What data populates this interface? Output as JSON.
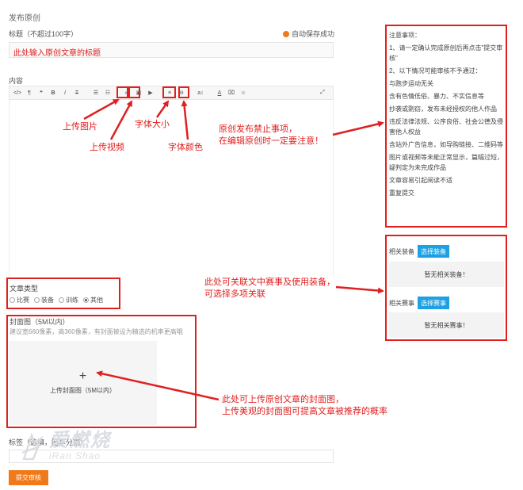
{
  "page": {
    "title": "发布原创"
  },
  "title_field": {
    "label": "标题（不超过100字）",
    "value": "此处输入原创文章的标题"
  },
  "autosave": {
    "text": "自动保存成功",
    "color": "#f07a1b"
  },
  "content": {
    "label": "内容"
  },
  "toolbar": {
    "icons": [
      "code-icon",
      "paragraph-icon",
      "quote-icon",
      "bold-icon",
      "italic-icon",
      "strikethrough-icon",
      "unordered-list-icon",
      "ordered-list-icon",
      "link-icon",
      "image-icon",
      "video-icon",
      "align-icon",
      "hr-icon",
      "font-size-icon",
      "font-color-icon",
      "clear-format-icon",
      "emoji-icon",
      "expand-icon"
    ],
    "glyphs": {
      "code": "</>",
      "paragraph": "¶",
      "quote": "❝",
      "bold": "B",
      "italic": "I",
      "strike": "T",
      "ul": "☰",
      "ol": "☷",
      "link": "∞",
      "image": "▣",
      "video": "▶",
      "align": "≡",
      "hr": "⊖",
      "fontsize": "a↕",
      "fontcolor": "A",
      "clear": "⌧",
      "emoji": "☺",
      "expand": "⤢"
    }
  },
  "annotations": {
    "upload_image": "上传图片",
    "upload_video": "上传视频",
    "font_size": "字体大小",
    "font_color": "字体颜色",
    "notice_warning_1": "原创发布禁止事项，",
    "notice_warning_2": "在编辑原创时一定要注意！",
    "relation_1": "此处可关联文中赛事及使用装备，",
    "relation_2": "可选择多项关联",
    "cover_1": "此处可上传原创文章的封面图，",
    "cover_2": "上传美观的封面图可提高文章被推荐的概率"
  },
  "article_type": {
    "label": "文章类型",
    "options": [
      {
        "label": "比赛",
        "selected": false
      },
      {
        "label": "装备",
        "selected": false
      },
      {
        "label": "训练",
        "selected": false
      },
      {
        "label": "其他",
        "selected": true
      }
    ]
  },
  "cover": {
    "label": "封面图（5M以内）",
    "hint": "建议宽660像素，高360像素，有封面被设为精选的机率更高哦",
    "plus": "+",
    "upload_text": "上传封面图（5M以内）"
  },
  "tags": {
    "label": "标签（选填，回车分割）"
  },
  "submit": {
    "label": "提交审核"
  },
  "notice": {
    "title": "注意事项：",
    "items": [
      "1、请一定确认完成原创后再点击\"提交审核\"",
      "2、以下情况可能审核不予通过：",
      "与跑步运动无关",
      "含有色情低俗、暴力、不实信息等",
      "抄袭或剽窃，发布未经授权的他人作品",
      "违反法律法规、公序良俗、社会公德及侵害他人权益",
      "含站外广告信息，如导购链接、二维码等",
      "图片或视频等未能正常显示，篇幅过短，疑判定为未完成作品",
      "文章容易引起阅读不适",
      "重复提交"
    ]
  },
  "related": {
    "equipment": {
      "label": "相关装备",
      "button": "选择装备",
      "empty": "暂无相关装备！"
    },
    "events": {
      "label": "相关赛事",
      "button": "选择赛事",
      "empty": "暂无相关赛事！"
    },
    "button_color": "#1da1e2"
  },
  "watermark": {
    "text": "爱燃烧",
    "sub": "iRan Shao"
  },
  "colors": {
    "annotation_red": "#e02020",
    "accent_orange": "#f07a1b"
  }
}
